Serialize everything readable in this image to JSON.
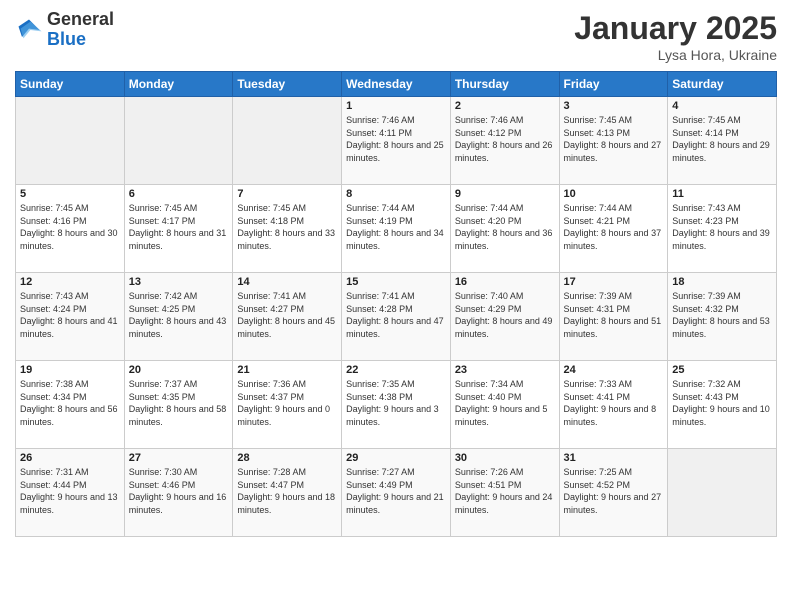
{
  "header": {
    "logo_general": "General",
    "logo_blue": "Blue",
    "title": "January 2025",
    "subtitle": "Lysa Hora, Ukraine"
  },
  "weekdays": [
    "Sunday",
    "Monday",
    "Tuesday",
    "Wednesday",
    "Thursday",
    "Friday",
    "Saturday"
  ],
  "weeks": [
    [
      {
        "day": "",
        "empty": true
      },
      {
        "day": "",
        "empty": true
      },
      {
        "day": "",
        "empty": true
      },
      {
        "day": "1",
        "sunrise": "7:46 AM",
        "sunset": "4:11 PM",
        "daylight": "8 hours and 25 minutes."
      },
      {
        "day": "2",
        "sunrise": "7:46 AM",
        "sunset": "4:12 PM",
        "daylight": "8 hours and 26 minutes."
      },
      {
        "day": "3",
        "sunrise": "7:45 AM",
        "sunset": "4:13 PM",
        "daylight": "8 hours and 27 minutes."
      },
      {
        "day": "4",
        "sunrise": "7:45 AM",
        "sunset": "4:14 PM",
        "daylight": "8 hours and 29 minutes."
      }
    ],
    [
      {
        "day": "5",
        "sunrise": "7:45 AM",
        "sunset": "4:16 PM",
        "daylight": "8 hours and 30 minutes."
      },
      {
        "day": "6",
        "sunrise": "7:45 AM",
        "sunset": "4:17 PM",
        "daylight": "8 hours and 31 minutes."
      },
      {
        "day": "7",
        "sunrise": "7:45 AM",
        "sunset": "4:18 PM",
        "daylight": "8 hours and 33 minutes."
      },
      {
        "day": "8",
        "sunrise": "7:44 AM",
        "sunset": "4:19 PM",
        "daylight": "8 hours and 34 minutes."
      },
      {
        "day": "9",
        "sunrise": "7:44 AM",
        "sunset": "4:20 PM",
        "daylight": "8 hours and 36 minutes."
      },
      {
        "day": "10",
        "sunrise": "7:44 AM",
        "sunset": "4:21 PM",
        "daylight": "8 hours and 37 minutes."
      },
      {
        "day": "11",
        "sunrise": "7:43 AM",
        "sunset": "4:23 PM",
        "daylight": "8 hours and 39 minutes."
      }
    ],
    [
      {
        "day": "12",
        "sunrise": "7:43 AM",
        "sunset": "4:24 PM",
        "daylight": "8 hours and 41 minutes."
      },
      {
        "day": "13",
        "sunrise": "7:42 AM",
        "sunset": "4:25 PM",
        "daylight": "8 hours and 43 minutes."
      },
      {
        "day": "14",
        "sunrise": "7:41 AM",
        "sunset": "4:27 PM",
        "daylight": "8 hours and 45 minutes."
      },
      {
        "day": "15",
        "sunrise": "7:41 AM",
        "sunset": "4:28 PM",
        "daylight": "8 hours and 47 minutes."
      },
      {
        "day": "16",
        "sunrise": "7:40 AM",
        "sunset": "4:29 PM",
        "daylight": "8 hours and 49 minutes."
      },
      {
        "day": "17",
        "sunrise": "7:39 AM",
        "sunset": "4:31 PM",
        "daylight": "8 hours and 51 minutes."
      },
      {
        "day": "18",
        "sunrise": "7:39 AM",
        "sunset": "4:32 PM",
        "daylight": "8 hours and 53 minutes."
      }
    ],
    [
      {
        "day": "19",
        "sunrise": "7:38 AM",
        "sunset": "4:34 PM",
        "daylight": "8 hours and 56 minutes."
      },
      {
        "day": "20",
        "sunrise": "7:37 AM",
        "sunset": "4:35 PM",
        "daylight": "8 hours and 58 minutes."
      },
      {
        "day": "21",
        "sunrise": "7:36 AM",
        "sunset": "4:37 PM",
        "daylight": "9 hours and 0 minutes."
      },
      {
        "day": "22",
        "sunrise": "7:35 AM",
        "sunset": "4:38 PM",
        "daylight": "9 hours and 3 minutes."
      },
      {
        "day": "23",
        "sunrise": "7:34 AM",
        "sunset": "4:40 PM",
        "daylight": "9 hours and 5 minutes."
      },
      {
        "day": "24",
        "sunrise": "7:33 AM",
        "sunset": "4:41 PM",
        "daylight": "9 hours and 8 minutes."
      },
      {
        "day": "25",
        "sunrise": "7:32 AM",
        "sunset": "4:43 PM",
        "daylight": "9 hours and 10 minutes."
      }
    ],
    [
      {
        "day": "26",
        "sunrise": "7:31 AM",
        "sunset": "4:44 PM",
        "daylight": "9 hours and 13 minutes."
      },
      {
        "day": "27",
        "sunrise": "7:30 AM",
        "sunset": "4:46 PM",
        "daylight": "9 hours and 16 minutes."
      },
      {
        "day": "28",
        "sunrise": "7:28 AM",
        "sunset": "4:47 PM",
        "daylight": "9 hours and 18 minutes."
      },
      {
        "day": "29",
        "sunrise": "7:27 AM",
        "sunset": "4:49 PM",
        "daylight": "9 hours and 21 minutes."
      },
      {
        "day": "30",
        "sunrise": "7:26 AM",
        "sunset": "4:51 PM",
        "daylight": "9 hours and 24 minutes."
      },
      {
        "day": "31",
        "sunrise": "7:25 AM",
        "sunset": "4:52 PM",
        "daylight": "9 hours and 27 minutes."
      },
      {
        "day": "",
        "empty": true
      }
    ]
  ],
  "labels": {
    "sunrise": "Sunrise:",
    "sunset": "Sunset:",
    "daylight": "Daylight:"
  }
}
